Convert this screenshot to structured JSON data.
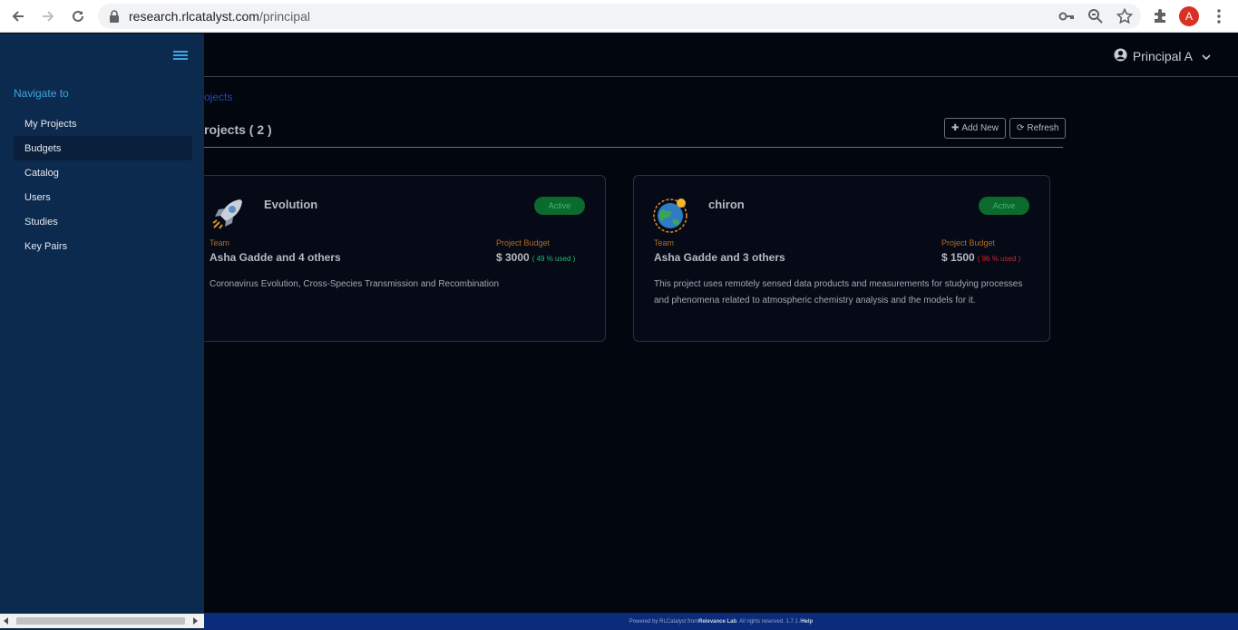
{
  "browser": {
    "url_host": "research.rlcatalyst.com",
    "url_path": "/principal",
    "profile_initial": "A"
  },
  "header": {
    "user_name": "Principal A"
  },
  "sidebar": {
    "title": "Navigate to",
    "items": [
      {
        "label": "My Projects"
      },
      {
        "label": "Budgets"
      },
      {
        "label": "Catalog"
      },
      {
        "label": "Users"
      },
      {
        "label": "Studies"
      },
      {
        "label": "Key Pairs"
      }
    ]
  },
  "main": {
    "breadcrumb": "ojects",
    "title": "rojects ( 2 )",
    "add_new_label": "Add New",
    "refresh_label": "Refresh"
  },
  "projects": [
    {
      "name": "Evolution",
      "status": "Active",
      "team_label": "Team",
      "team": "Asha Gadde and 4 others",
      "budget_label": "Project Budget",
      "budget": "$ 3000",
      "used": "( 49 % used )",
      "used_color": "#2bb673",
      "description": "Coronavirus Evolution, Cross-Species Transmission and Recombination",
      "icon": "rocket-icon"
    },
    {
      "name": "chiron",
      "status": "Active",
      "team_label": "Team",
      "team": "Asha Gadde and 3 others",
      "budget_label": "Project Budget",
      "budget": "$ 1500",
      "used": "( 96 % used )",
      "used_color": "#d0282c",
      "description": "This project uses remotely sensed data products and measurements for studying processes and phenomena related to atmospheric chemistry analysis and the models for it.",
      "icon": "earth-icon"
    }
  ],
  "footer": {
    "text_pre": "Powered by RLCatalyst from ",
    "company": "Relevance Lab",
    "text_post": ". All rights reserved. 1.7.1 / ",
    "help": "Help"
  },
  "colors": {
    "sidebar_bg": "#0c2a4e",
    "page_bg": "#02060f",
    "accent": "#3ea3e3",
    "active_badge": "#0c6a2f",
    "label_orange": "#b66b1d",
    "footer_bg": "#0b2c7a"
  }
}
